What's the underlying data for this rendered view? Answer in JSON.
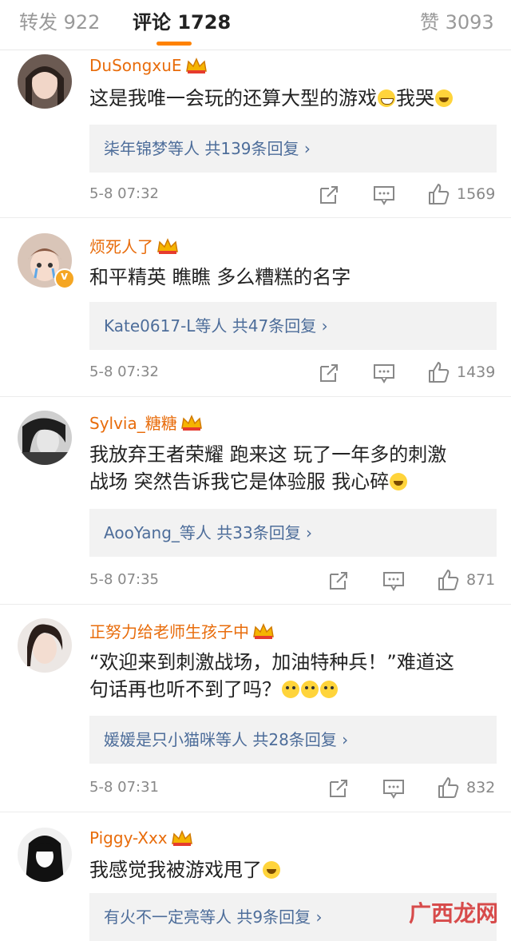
{
  "tabs": {
    "repost": "转发 922",
    "comments": "评论 1728",
    "likes": "赞 3093"
  },
  "colors": {
    "accent": "#ff8200",
    "username": "#e86c0b",
    "reply_link": "#4d6d9a"
  },
  "comments": [
    {
      "user": "DuSongxuE",
      "text_parts": [
        "这是我唯一会玩的还算大型的游戏",
        "我哭"
      ],
      "emojis": [
        "laugh-emoji",
        "cry-emoji"
      ],
      "replies": "柒年锦梦等人  共139条回复 ›",
      "time": "5-8 07:32",
      "likes": "1569"
    },
    {
      "user": "烦死人了",
      "text": "和平精英 瞧瞧 多么糟糕的名字",
      "replies": "Kate0617-L等人  共47条回复 ›",
      "time": "5-8 07:32",
      "likes": "1439"
    },
    {
      "user": "Sylvia_糖糖",
      "text_line1": "我放弃王者荣耀 跑来这 玩了一年多的刺激",
      "text_line2": "战场 突然告诉我它是体验服 我心碎",
      "replies": "AooYang_等人  共33条回复 ›",
      "time": "5-8 07:35",
      "likes": "871"
    },
    {
      "user": "正努力给老师生孩子中",
      "text_line1": "“欢迎来到刺激战场，加油特种兵！”难道这",
      "text_line2": "句话再也听不到了吗？",
      "replies": "媛媛是只小猫咪等人  共28条回复 ›",
      "time": "5-8 07:31",
      "likes": "832"
    },
    {
      "user": "Piggy-Xxx",
      "text": "我感觉我被游戏甩了",
      "replies": "有火不一定亮等人  共9条回复 ›"
    }
  ],
  "watermark": "广西龙网"
}
